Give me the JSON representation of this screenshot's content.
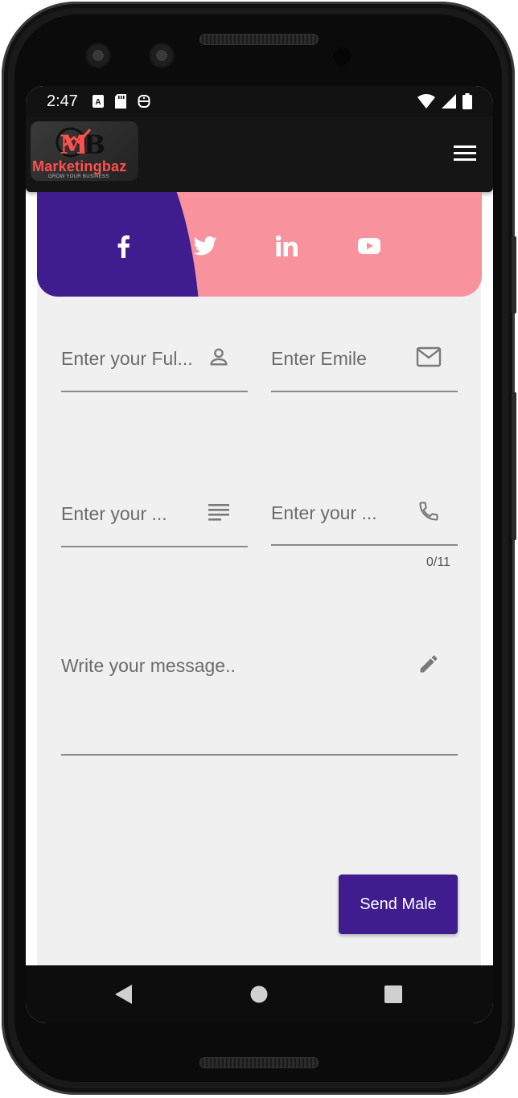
{
  "status_bar": {
    "time": "2:47"
  },
  "app_bar": {
    "logo_text": "Marketingbaz",
    "logo_mark": "MB",
    "logo_tagline": "GROW YOUR BUSINESS"
  },
  "social": [
    {
      "name": "facebook-icon",
      "color": "#ffffff"
    },
    {
      "name": "twitter-icon",
      "color": "#ffffff"
    },
    {
      "name": "linkedin-icon",
      "color": "#ffffff"
    },
    {
      "name": "youtube-icon",
      "color": "#ffffff"
    }
  ],
  "form": {
    "full_name_placeholder": "Enter your Ful...",
    "email_placeholder": "Enter Emile",
    "subject_placeholder": "Enter your ...",
    "phone_placeholder": "Enter your ...",
    "phone_counter": "0/11",
    "message_placeholder": "Write your message..",
    "send_label": "Send Male"
  },
  "colors": {
    "primary_purple": "#3f1d8f",
    "social_pink": "#f8939d",
    "background": "#f0f0f0",
    "app_bar": "#151515"
  }
}
